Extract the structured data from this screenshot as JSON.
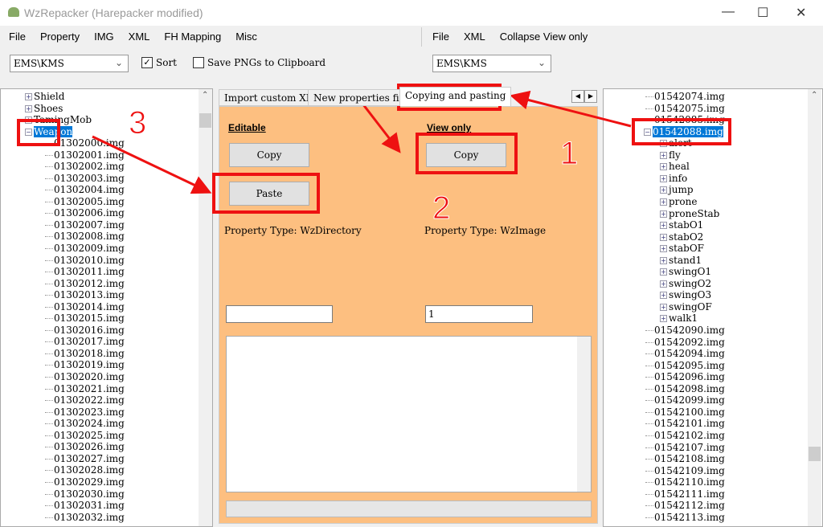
{
  "window": {
    "title": "WzRepacker (Harepacker modified)",
    "minimize": "—",
    "maximize": "☐",
    "close": "✕"
  },
  "menu_left": [
    "File",
    "Property",
    "IMG",
    "XML",
    "FH Mapping",
    "Misc"
  ],
  "menu_right": [
    "File",
    "XML",
    "Collapse View only"
  ],
  "toolbar": {
    "left_combo": "EMS\\KMS",
    "sort_label": "Sort",
    "sort_checked": true,
    "save_png_label": "Save PNGs to Clipboard",
    "save_png_checked": false,
    "right_combo": "EMS\\KMS"
  },
  "left_tree": {
    "parents": [
      "Shield",
      "Shoes",
      "TamingMob",
      "Weapon"
    ],
    "selected": "Weapon",
    "children": [
      "01302000.img",
      "01302001.img",
      "01302002.img",
      "01302003.img",
      "01302004.img",
      "01302005.img",
      "01302006.img",
      "01302007.img",
      "01302008.img",
      "01302009.img",
      "01302010.img",
      "01302011.img",
      "01302012.img",
      "01302013.img",
      "01302014.img",
      "01302015.img",
      "01302016.img",
      "01302017.img",
      "01302018.img",
      "01302019.img",
      "01302020.img",
      "01302021.img",
      "01302022.img",
      "01302023.img",
      "01302024.img",
      "01302025.img",
      "01302026.img",
      "01302027.img",
      "01302028.img",
      "01302029.img",
      "01302030.img",
      "01302031.img",
      "01302032.img"
    ]
  },
  "tabs": [
    "Import custom XML",
    "New properties finder",
    "Copying and pasting"
  ],
  "active_tab": "Copying and pasting",
  "panel": {
    "editable_label": "Editable",
    "copy_label": "Copy",
    "paste_label": "Paste",
    "view_only_label": "View only",
    "view_copy_label": "Copy",
    "editable_type": "Property Type: WzDirectory",
    "view_type": "Property Type: WzImage",
    "editable_input": "",
    "view_input": "1",
    "textarea": ""
  },
  "right_tree": {
    "before": [
      "01542074.img",
      "01542075.img",
      "01542085.img"
    ],
    "selected": "01542088.img",
    "sub": [
      "alert",
      "fly",
      "heal",
      "info",
      "jump",
      "prone",
      "proneStab",
      "stabO1",
      "stabO2",
      "stabOF",
      "stand1",
      "swingO1",
      "swingO2",
      "swingO3",
      "swingOF",
      "walk1"
    ],
    "after": [
      "01542090.img",
      "01542092.img",
      "01542094.img",
      "01542095.img",
      "01542096.img",
      "01542098.img",
      "01542099.img",
      "01542100.img",
      "01542101.img",
      "01542102.img",
      "01542107.img",
      "01542108.img",
      "01542109.img",
      "01542110.img",
      "01542111.img",
      "01542112.img",
      "01542113.img"
    ]
  },
  "annotations": {
    "labels": [
      "1",
      "2",
      "3"
    ],
    "color": "#ee1111"
  },
  "colors": {
    "panel": "#fdbf80",
    "selection": "#0078d7"
  }
}
